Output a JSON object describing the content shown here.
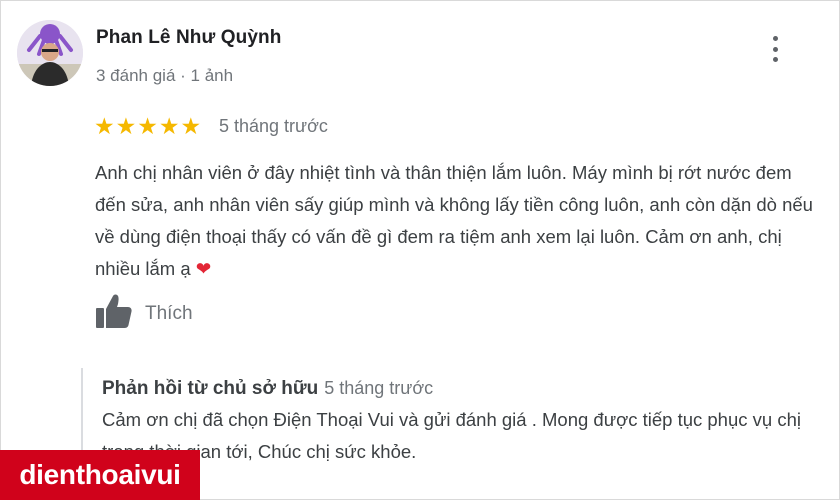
{
  "reviewer": {
    "name": "Phan Lê Như Quỳnh",
    "meta": "3 đánh giá · 1 ảnh"
  },
  "review": {
    "rating": 5,
    "rating_max": 5,
    "time": "5 tháng trước",
    "text": "Anh chị nhân viên ở đây nhiệt tình và thân thiện lắm luôn. Máy mình bị rớt nước đem đến sửa, anh nhân viên sấy giúp mình và không lấy tiền công luôn, anh còn dặn dò nếu về dùng điện thoại thấy có vấn đề gì đem ra tiệm anh xem lại luôn. Cảm ơn anh, chị nhiều lắm ạ",
    "emoji": "❤"
  },
  "actions": {
    "like_label": "Thích"
  },
  "owner_reply": {
    "author": "Phản hồi từ chủ sở hữu",
    "time": "5 tháng trước",
    "text": "Cảm ơn chị đã chọn Điện Thoại Vui và gửi đánh giá . Mong được tiếp tục phục vụ chị trong thời gian tới, Chúc chị sức khỏe."
  },
  "watermark": {
    "text": "dienthoaivui"
  },
  "colors": {
    "star": "#f5b800",
    "heart": "#e32636",
    "watermark_bg": "#d0021b",
    "muted_text": "#70757a"
  }
}
